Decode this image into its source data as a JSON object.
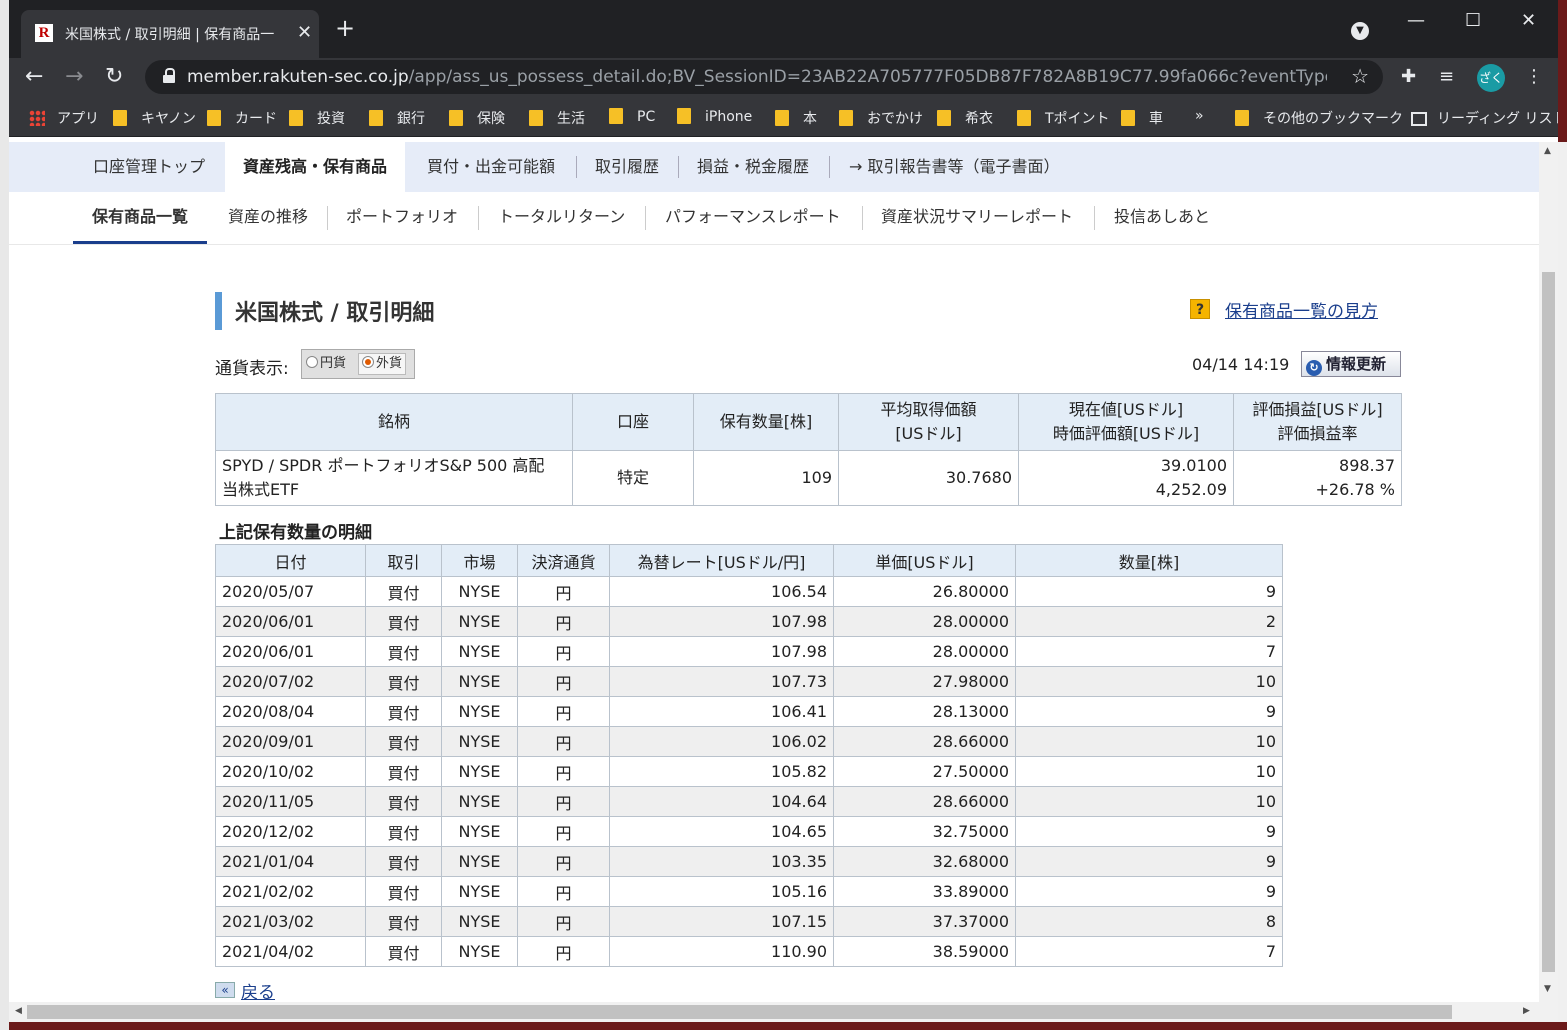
{
  "browser": {
    "tab_title": "米国株式 / 取引明細 | 保有商品一",
    "favicon": "R",
    "url_host": "member.rakuten-sec.co.jp",
    "url_path": "/app/ass_us_possess_detail.do;BV_SessionID=23AB22A705777F05DB87F782A8B19C77.99fa066c?eventType=init&dscrCd...",
    "avatar": "ざく",
    "bookmarks": [
      "アプリ",
      "キヤノン",
      "カード",
      "投資",
      "銀行",
      "保険",
      "生活",
      "PC",
      "iPhone",
      "本",
      "おでかけ",
      "希衣",
      "Tポイント",
      "車"
    ],
    "more": "»",
    "other_bookmarks": "その他のブックマーク",
    "reading_list": "リーディング リスト"
  },
  "nav1": [
    "口座管理トップ",
    "資産残高・保有商品",
    "買付・出金可能額",
    "取引履歴",
    "損益・税金履歴",
    "→ 取引報告書等（電子書面）"
  ],
  "nav2": [
    "保有商品一覧",
    "資産の推移",
    "ポートフォリオ",
    "トータルリターン",
    "パフォーマンスレポート",
    "資産状況サマリーレポート",
    "投信あしあと"
  ],
  "page": {
    "title": "米国株式 / 取引明細",
    "help_icon": "?",
    "help_link": "保有商品一覧の見方",
    "currency_label": "通貨表示:",
    "currency_jpy": "円貨",
    "currency_fx": "外貨",
    "timestamp": "04/14 14:19",
    "refresh": "情報更新",
    "detail_heading": "上記保有数量の明細",
    "back_icon": "«",
    "back": "戻る"
  },
  "summary": {
    "headers": [
      "銘柄",
      "口座",
      "保有数量[株]",
      "平均取得価額",
      "[USドル]",
      "現在値[USドル]",
      "時価評価額[USドル]",
      "評価損益[USドル]",
      "評価損益率"
    ],
    "row": {
      "name_line1": "SPYD / SPDR ポートフォリオS&P 500 高配",
      "name_line2": "当株式ETF",
      "account": "特定",
      "quantity": "109",
      "avg_price": "30.7680",
      "current_price": "39.0100",
      "market_value": "4,252.09",
      "pl": "898.37",
      "pl_rate": "+26.78 %"
    }
  },
  "detail": {
    "headers": [
      "日付",
      "取引",
      "市場",
      "決済通貨",
      "為替レート[USドル/円]",
      "単価[USドル]",
      "数量[株]"
    ],
    "rows": [
      [
        "2020/05/07",
        "買付",
        "NYSE",
        "円",
        "106.54",
        "26.80000",
        "9"
      ],
      [
        "2020/06/01",
        "買付",
        "NYSE",
        "円",
        "107.98",
        "28.00000",
        "2"
      ],
      [
        "2020/06/01",
        "買付",
        "NYSE",
        "円",
        "107.98",
        "28.00000",
        "7"
      ],
      [
        "2020/07/02",
        "買付",
        "NYSE",
        "円",
        "107.73",
        "27.98000",
        "10"
      ],
      [
        "2020/08/04",
        "買付",
        "NYSE",
        "円",
        "106.41",
        "28.13000",
        "9"
      ],
      [
        "2020/09/01",
        "買付",
        "NYSE",
        "円",
        "106.02",
        "28.66000",
        "10"
      ],
      [
        "2020/10/02",
        "買付",
        "NYSE",
        "円",
        "105.82",
        "27.50000",
        "10"
      ],
      [
        "2020/11/05",
        "買付",
        "NYSE",
        "円",
        "104.64",
        "28.66000",
        "10"
      ],
      [
        "2020/12/02",
        "買付",
        "NYSE",
        "円",
        "104.65",
        "32.75000",
        "9"
      ],
      [
        "2021/01/04",
        "買付",
        "NYSE",
        "円",
        "103.35",
        "32.68000",
        "9"
      ],
      [
        "2021/02/02",
        "買付",
        "NYSE",
        "円",
        "105.16",
        "33.89000",
        "9"
      ],
      [
        "2021/03/02",
        "買付",
        "NYSE",
        "円",
        "107.15",
        "37.37000",
        "8"
      ],
      [
        "2021/04/02",
        "買付",
        "NYSE",
        "円",
        "110.90",
        "38.59000",
        "7"
      ]
    ]
  }
}
